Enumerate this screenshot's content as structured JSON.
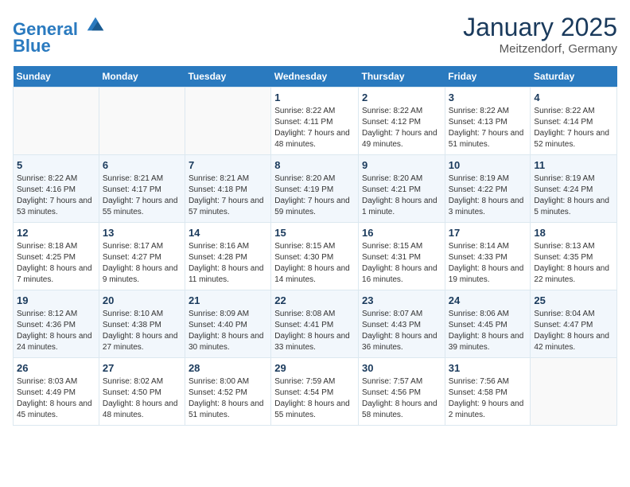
{
  "header": {
    "logo_line1": "General",
    "logo_line2": "Blue",
    "month": "January 2025",
    "location": "Meitzendorf, Germany"
  },
  "weekdays": [
    "Sunday",
    "Monday",
    "Tuesday",
    "Wednesday",
    "Thursday",
    "Friday",
    "Saturday"
  ],
  "weeks": [
    [
      {
        "day": "",
        "info": ""
      },
      {
        "day": "",
        "info": ""
      },
      {
        "day": "",
        "info": ""
      },
      {
        "day": "1",
        "info": "Sunrise: 8:22 AM\nSunset: 4:11 PM\nDaylight: 7 hours and 48 minutes."
      },
      {
        "day": "2",
        "info": "Sunrise: 8:22 AM\nSunset: 4:12 PM\nDaylight: 7 hours and 49 minutes."
      },
      {
        "day": "3",
        "info": "Sunrise: 8:22 AM\nSunset: 4:13 PM\nDaylight: 7 hours and 51 minutes."
      },
      {
        "day": "4",
        "info": "Sunrise: 8:22 AM\nSunset: 4:14 PM\nDaylight: 7 hours and 52 minutes."
      }
    ],
    [
      {
        "day": "5",
        "info": "Sunrise: 8:22 AM\nSunset: 4:16 PM\nDaylight: 7 hours and 53 minutes."
      },
      {
        "day": "6",
        "info": "Sunrise: 8:21 AM\nSunset: 4:17 PM\nDaylight: 7 hours and 55 minutes."
      },
      {
        "day": "7",
        "info": "Sunrise: 8:21 AM\nSunset: 4:18 PM\nDaylight: 7 hours and 57 minutes."
      },
      {
        "day": "8",
        "info": "Sunrise: 8:20 AM\nSunset: 4:19 PM\nDaylight: 7 hours and 59 minutes."
      },
      {
        "day": "9",
        "info": "Sunrise: 8:20 AM\nSunset: 4:21 PM\nDaylight: 8 hours and 1 minute."
      },
      {
        "day": "10",
        "info": "Sunrise: 8:19 AM\nSunset: 4:22 PM\nDaylight: 8 hours and 3 minutes."
      },
      {
        "day": "11",
        "info": "Sunrise: 8:19 AM\nSunset: 4:24 PM\nDaylight: 8 hours and 5 minutes."
      }
    ],
    [
      {
        "day": "12",
        "info": "Sunrise: 8:18 AM\nSunset: 4:25 PM\nDaylight: 8 hours and 7 minutes."
      },
      {
        "day": "13",
        "info": "Sunrise: 8:17 AM\nSunset: 4:27 PM\nDaylight: 8 hours and 9 minutes."
      },
      {
        "day": "14",
        "info": "Sunrise: 8:16 AM\nSunset: 4:28 PM\nDaylight: 8 hours and 11 minutes."
      },
      {
        "day": "15",
        "info": "Sunrise: 8:15 AM\nSunset: 4:30 PM\nDaylight: 8 hours and 14 minutes."
      },
      {
        "day": "16",
        "info": "Sunrise: 8:15 AM\nSunset: 4:31 PM\nDaylight: 8 hours and 16 minutes."
      },
      {
        "day": "17",
        "info": "Sunrise: 8:14 AM\nSunset: 4:33 PM\nDaylight: 8 hours and 19 minutes."
      },
      {
        "day": "18",
        "info": "Sunrise: 8:13 AM\nSunset: 4:35 PM\nDaylight: 8 hours and 22 minutes."
      }
    ],
    [
      {
        "day": "19",
        "info": "Sunrise: 8:12 AM\nSunset: 4:36 PM\nDaylight: 8 hours and 24 minutes."
      },
      {
        "day": "20",
        "info": "Sunrise: 8:10 AM\nSunset: 4:38 PM\nDaylight: 8 hours and 27 minutes."
      },
      {
        "day": "21",
        "info": "Sunrise: 8:09 AM\nSunset: 4:40 PM\nDaylight: 8 hours and 30 minutes."
      },
      {
        "day": "22",
        "info": "Sunrise: 8:08 AM\nSunset: 4:41 PM\nDaylight: 8 hours and 33 minutes."
      },
      {
        "day": "23",
        "info": "Sunrise: 8:07 AM\nSunset: 4:43 PM\nDaylight: 8 hours and 36 minutes."
      },
      {
        "day": "24",
        "info": "Sunrise: 8:06 AM\nSunset: 4:45 PM\nDaylight: 8 hours and 39 minutes."
      },
      {
        "day": "25",
        "info": "Sunrise: 8:04 AM\nSunset: 4:47 PM\nDaylight: 8 hours and 42 minutes."
      }
    ],
    [
      {
        "day": "26",
        "info": "Sunrise: 8:03 AM\nSunset: 4:49 PM\nDaylight: 8 hours and 45 minutes."
      },
      {
        "day": "27",
        "info": "Sunrise: 8:02 AM\nSunset: 4:50 PM\nDaylight: 8 hours and 48 minutes."
      },
      {
        "day": "28",
        "info": "Sunrise: 8:00 AM\nSunset: 4:52 PM\nDaylight: 8 hours and 51 minutes."
      },
      {
        "day": "29",
        "info": "Sunrise: 7:59 AM\nSunset: 4:54 PM\nDaylight: 8 hours and 55 minutes."
      },
      {
        "day": "30",
        "info": "Sunrise: 7:57 AM\nSunset: 4:56 PM\nDaylight: 8 hours and 58 minutes."
      },
      {
        "day": "31",
        "info": "Sunrise: 7:56 AM\nSunset: 4:58 PM\nDaylight: 9 hours and 2 minutes."
      },
      {
        "day": "",
        "info": ""
      }
    ]
  ]
}
